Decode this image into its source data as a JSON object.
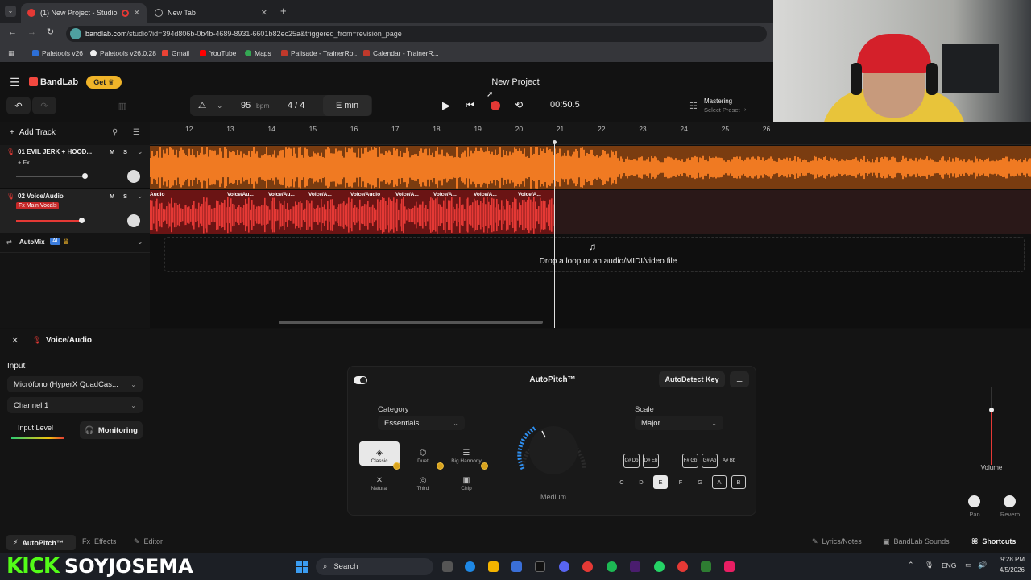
{
  "browser": {
    "tabs": [
      {
        "title": "(1) New Project - Studio"
      },
      {
        "title": "New Tab"
      }
    ],
    "url_host": "bandlab.com",
    "url_path": "/studio?id=394d806b-0b4b-4689-8931-6601b82ec25a&triggered_from=revision_page",
    "bookmarks": [
      "Paletools v26",
      "Paletools v26.0.28",
      "Gmail",
      "YouTube",
      "Maps",
      "Palisade - TrainerRo...",
      "Calendar - TrainerR..."
    ]
  },
  "header": {
    "logo": "BandLab",
    "get_label": "Get",
    "project_title": "New Project",
    "bpm_value": "95",
    "bpm_unit": "bpm",
    "time_sig": "4 / 4",
    "key": "E min",
    "time": "00:50.5",
    "mastering_label": "Mastering",
    "mastering_sub": "Select Preset"
  },
  "tracks": {
    "add_track": "Add Track",
    "list": [
      {
        "name": "01  EVIL JERK + HOOD...",
        "fx": "+ Fx",
        "m": "M",
        "s": "S"
      },
      {
        "name": "02  Voice/Audio",
        "fx": "Fx Main Vocals",
        "m": "M",
        "s": "S"
      }
    ],
    "automix": "AutoMix",
    "ai_badge": "AI"
  },
  "timeline": {
    "ruler": [
      "12",
      "13",
      "14",
      "15",
      "16",
      "17",
      "18",
      "19",
      "20",
      "21",
      "22",
      "23",
      "24",
      "25",
      "26"
    ],
    "clip_labels": [
      "Audio",
      "Voice/Au...",
      "Voice/Au...",
      "Voice/A...",
      "Voice/Audio",
      "Voice/A...",
      "Voice/A...",
      "Voice/A...",
      "Voice/A..."
    ],
    "drop_text": "Drop a loop or an audio/MIDI/video file"
  },
  "panel": {
    "track_title": "Voice/Audio",
    "input_label": "Input",
    "input_device": "Micrófono (HyperX QuadCas...",
    "channel": "Channel 1",
    "input_level": "Input Level",
    "monitoring": "Monitoring",
    "autopitch": {
      "title": "AutoPitch™",
      "autodetect": "AutoDetect Key",
      "category_label": "Category",
      "category_value": "Essentials",
      "modes": [
        "Classic",
        "Duet",
        "Big Harmony",
        "Natural",
        "Third",
        "Chip"
      ],
      "knob_label": "Medium",
      "scale_label": "Scale",
      "scale_value": "Major",
      "accidentals": [
        "C# Db",
        "D# Eb",
        "F# Gb",
        "G# Ab",
        "A# Bb"
      ],
      "keys": [
        "C",
        "D",
        "E",
        "F",
        "G",
        "A",
        "B"
      ],
      "selected_key": "E"
    },
    "volume_label": "Volume",
    "pan_label": "Pan",
    "reverb_label": "Reverb"
  },
  "bottombar": {
    "left": [
      "AutoPitch™",
      "Effects",
      "Editor"
    ],
    "right": [
      "Lyrics/Notes",
      "BandLab Sounds",
      "Shortcuts"
    ]
  },
  "overlay": {
    "kick": "KICK",
    "handle": "SOYJOSEMA"
  },
  "taskbar": {
    "search": "Search",
    "lang": "ENG",
    "time": "9:28 PM",
    "date": "4/5/2026"
  }
}
